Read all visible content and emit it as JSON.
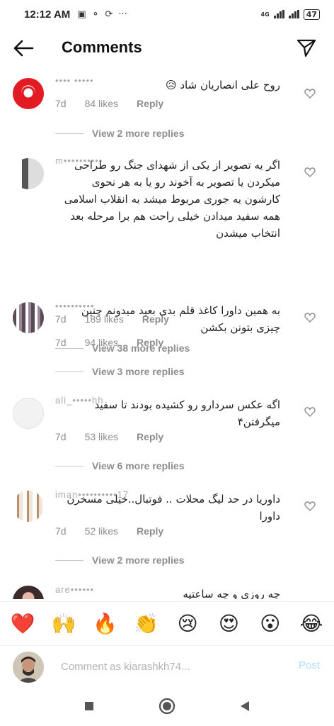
{
  "status_bar": {
    "time": "12:12 AM",
    "network": "4G",
    "battery": "47"
  },
  "header": {
    "title": "Comments"
  },
  "comments": [
    {
      "username": "•••• •••••",
      "text": "روح علی انصاریان شاد 😥",
      "time": "7d",
      "likes": "84 likes",
      "reply": "Reply",
      "view_replies": "View 2 more replies"
    },
    {
      "username": "m••••••••••",
      "text": "اگر یه تصویر از یکی از شهدای جنگ رو طراحی میکردن یا تصویر به آخوند رو یا به هر نحوی کارشون یه جوری مربوط میشد به انقلاب اسلامی همه سفید میدادن خیلی راحت هم برا مرحله بعد انتخاب میشدن",
      "time": "7d",
      "likes": "189 likes",
      "reply": "Reply",
      "view_replies": "View 38 more replies"
    },
    {
      "username": "••••••••••",
      "text": "به همین داورا کاغذ قلم بدی بعید میدونم چنین چیزی بتونن بکشن",
      "time": "7d",
      "likes": "94 likes",
      "reply": "Reply",
      "view_replies": "View 3 more replies"
    },
    {
      "username": "ali_•••••hh",
      "text": "اگه عکس سردارو رو کشیده بودند تا سفید میگرفتن۴",
      "time": "7d",
      "likes": "53 likes",
      "reply": "Reply",
      "view_replies": "View 6 more replies"
    },
    {
      "username": "iman••••••••••17",
      "text": "داوریا در حد لیگ محلات .. فوتبال..خیلی مسخرن داورا",
      "time": "7d",
      "likes": "52 likes",
      "reply": "Reply",
      "view_replies": "View 2 more replies"
    },
    {
      "username": "are••••••",
      "text": "چه روزی و چه ساعتیه"
    }
  ],
  "reactions": [
    "❤️",
    "🙌",
    "🔥",
    "👏",
    "😢",
    "😍",
    "😮",
    "😂"
  ],
  "comment_bar": {
    "placeholder": "Comment as kiarashkh74...",
    "post_label": "Post"
  },
  "colors": {
    "accent_post": "#b3dbff",
    "secondary_text": "#8e8e8e"
  }
}
